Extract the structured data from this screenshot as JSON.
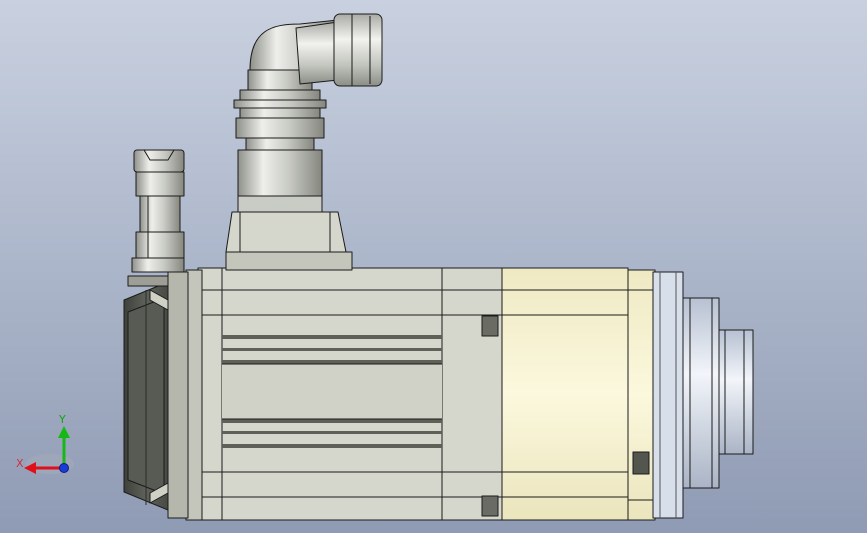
{
  "window": {
    "title": ""
  },
  "viewport": {
    "background_top": "#c9d1e0",
    "background_bottom": "#8f9bb4"
  },
  "triad": {
    "x_label": "X",
    "y_label": "Y",
    "x_color": "#e0101a",
    "y_color": "#16b816",
    "z_color": "#1a3bd8",
    "label_color": "#d0303a",
    "y_label_color": "#18a018"
  },
  "model": {
    "name": "servo-motor",
    "housing_color": "#d5d6cc",
    "housing_shadow": "#b9bab0",
    "flange_color": "#f7f3cf",
    "encoder_cover_color": "#53564f",
    "connector_metal": "#c7c9c3",
    "edge_color": "#1b1b1b",
    "shaft_hub_color": "#dce4f0"
  }
}
